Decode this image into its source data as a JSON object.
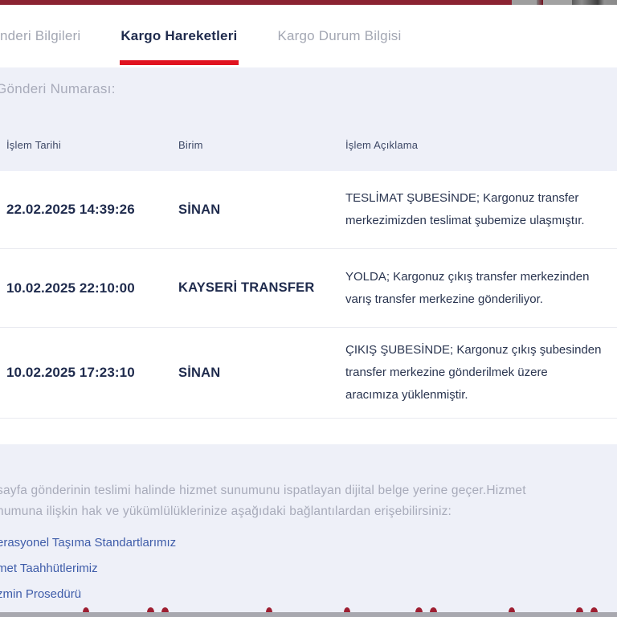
{
  "tabs": [
    {
      "label": "nderi Bilgileri",
      "active": false
    },
    {
      "label": "Kargo Hareketleri",
      "active": true
    },
    {
      "label": "Kargo Durum Bilgisi",
      "active": false
    }
  ],
  "shipment": {
    "number_label": "Gönderi Numarası:"
  },
  "table": {
    "columns": [
      "İşlem Tarihi",
      "Birim",
      "İşlem Açıklama"
    ],
    "rows": [
      {
        "date": "22.02.2025 14:39:26",
        "unit": "SİNAN",
        "description": "TESLİMAT ŞUBESİNDE; Kargonuz transfer merkezimizden teslimat şubemize ulaşmıştır."
      },
      {
        "date": "10.02.2025 22:10:00",
        "unit": "KAYSERİ TRANSFER",
        "description": "YOLDA; Kargonuz çıkış transfer merkezinden varış transfer merkezine gönderiliyor."
      },
      {
        "date": "10.02.2025 17:23:10",
        "unit": "SİNAN",
        "description": "ÇIKIŞ ŞUBESİNDE; Kargonuz çıkış şubesinden transfer merkezine gönderilmek üzere aracımıza yüklenmiştir."
      }
    ]
  },
  "footer": {
    "disclaimer_line1": "sayfa gönderinin teslimi halinde hizmet sunumunu ispatlayan dijital belge yerine geçer.Hizmet",
    "disclaimer_line2": "numuna ilişkin hak ve yükümlülüklerinize aşağıdaki bağlantılardan erişebilirsiniz:",
    "links": [
      {
        "label": "erasyonel Taşıma Standartlarımız"
      },
      {
        "label": "met Taahhütlerimiz"
      },
      {
        "label": "zmin Prosedürü"
      }
    ]
  },
  "colors": {
    "accent_red": "#E01320",
    "topbar_maroon": "#8B2332",
    "navy_text": "#1F2B4D",
    "link_blue": "#3E5CA9",
    "band_lavender": "#EEF0F8"
  }
}
